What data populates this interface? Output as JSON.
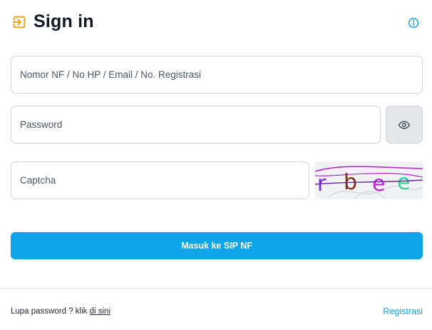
{
  "header": {
    "title": "Sign in",
    "icon": "login-icon",
    "info_icon": "info-icon",
    "accent_color": "#f2a51a"
  },
  "form": {
    "username_placeholder": "Nomor NF / No HP / Email / No. Registrasi",
    "username_value": "",
    "password_placeholder": "Password",
    "password_value": "",
    "password_toggle_icon": "eye-icon",
    "captcha_placeholder": "Captcha",
    "captcha_value": "",
    "captcha_image_text": "rbee",
    "submit_label": "Masuk ke SIP NF",
    "submit_color": "#0ea5e9"
  },
  "footer": {
    "forgot_text": "Lupa password ? klik",
    "forgot_link": "di sini",
    "register_link": "Registrasi",
    "link_color": "#0ea5e9"
  }
}
